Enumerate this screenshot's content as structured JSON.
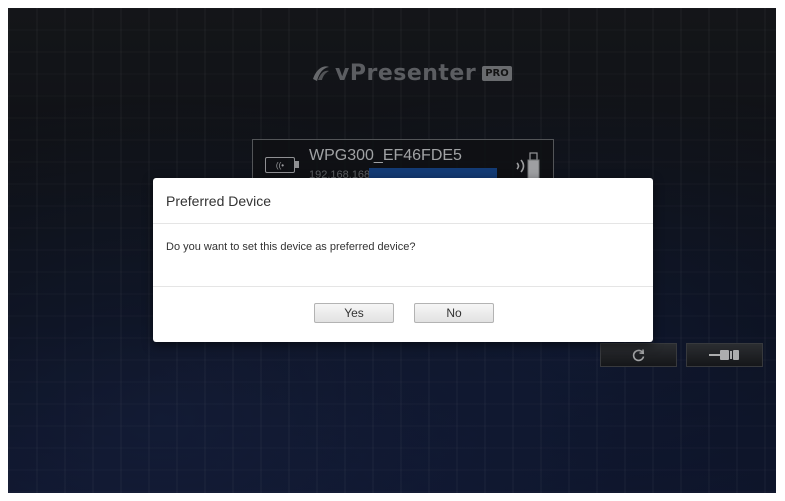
{
  "app": {
    "logo_text": "vPresenter",
    "logo_badge": "PRO"
  },
  "device": {
    "name": "WPG300_EF46FDE5",
    "ip_partial": "192.168.168.1",
    "icon": "usb-dongle-icon",
    "status_icon": "wireless-usb-icon",
    "progress_color": "#1a4f9c"
  },
  "actions": {
    "refresh_icon": "refresh-icon",
    "connect_icon": "plug-icon"
  },
  "dialog": {
    "title": "Preferred Device",
    "message": "Do you want to set this device as preferred device?",
    "yes_label": "Yes",
    "no_label": "No"
  },
  "colors": {
    "background": "#14171d",
    "dialog_bg": "#ffffff",
    "logo_text": "#7a7c82"
  }
}
